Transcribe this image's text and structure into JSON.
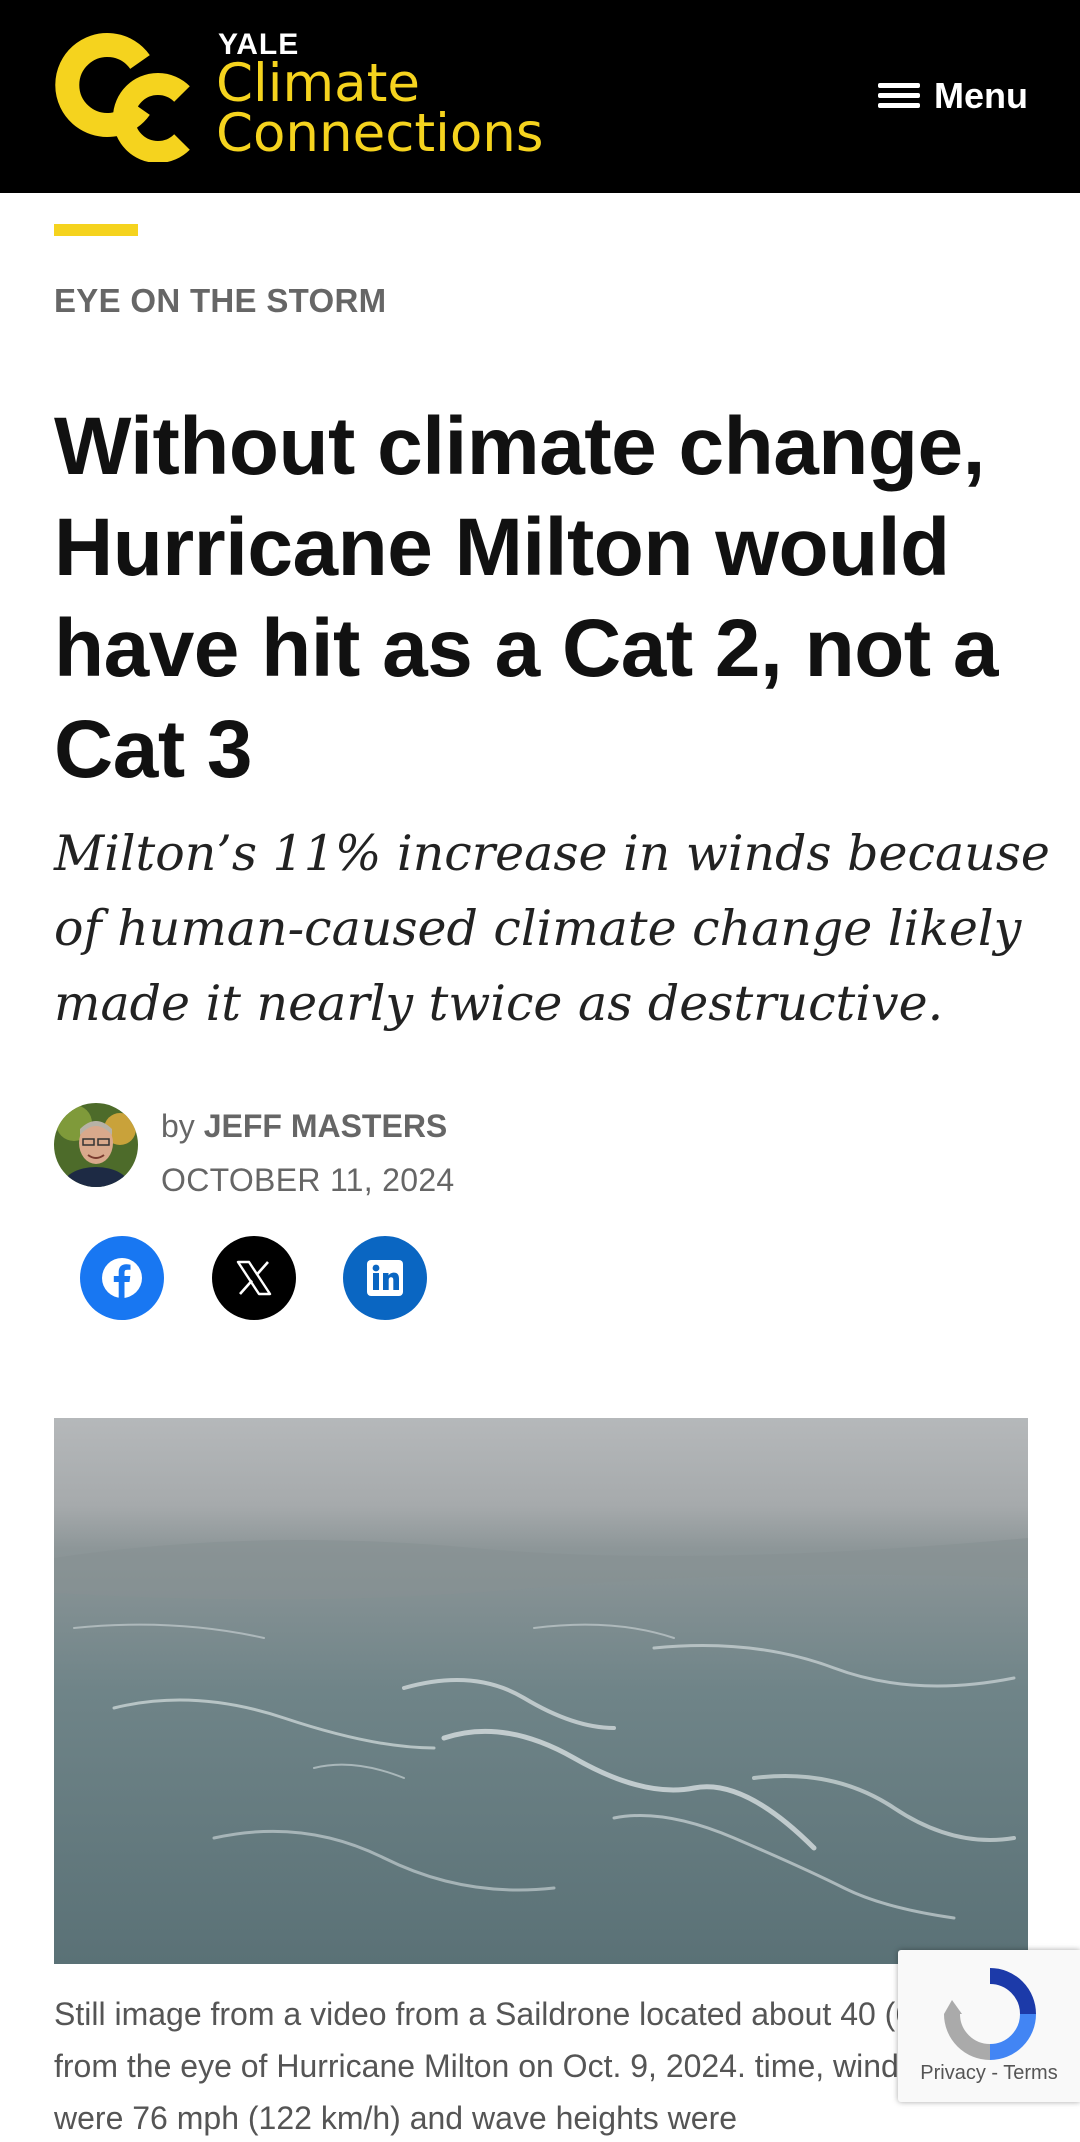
{
  "header": {
    "logo": {
      "line_top": "YALE",
      "line_1": "Climate",
      "line_2": "Connections"
    },
    "menu_label": "Menu"
  },
  "article": {
    "category": "EYE ON THE STORM",
    "headline": "Without climate change, Hurricane Milton would have hit as a Cat 2, not a Cat 3",
    "deck": "Milton’s 11% increase in winds because of human-caused climate change likely made it nearly twice as destructive.",
    "byline_prefix": "by ",
    "author": "JEFF MASTERS",
    "date": "OCTOBER 11, 2024",
    "share": [
      {
        "network": "facebook",
        "icon": "facebook-icon"
      },
      {
        "network": "x",
        "icon": "x-icon"
      },
      {
        "network": "linkedin",
        "icon": "linkedin-icon"
      }
    ],
    "caption": "Still image from a video from a Saildrone located about 40 (65 km) from the eye of Hurricane Milton on Oct. 9, 2024. time, wind gusts were 76 mph (122 km/h) and wave heights were"
  },
  "recaptcha": {
    "privacy": "Privacy",
    "separator": " - ",
    "terms": "Terms"
  },
  "colors": {
    "brand_yellow": "#f5d31e",
    "header_bg": "#000000",
    "facebook": "#1877f2",
    "linkedin": "#0a66c2"
  }
}
